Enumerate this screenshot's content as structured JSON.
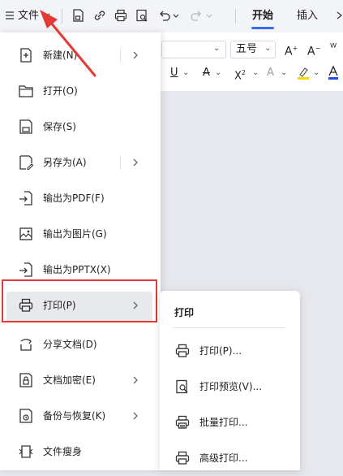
{
  "toolbar": {
    "file_label": "文件",
    "tabs": [
      {
        "label": "开始",
        "active": true
      },
      {
        "label": "插入",
        "active": false
      }
    ]
  },
  "ribbon": {
    "font_size": "五号"
  },
  "file_menu": {
    "items": [
      {
        "label": "新建(N)",
        "icon": "new-file-icon",
        "has_submenu": true
      },
      {
        "label": "打开(O)",
        "icon": "folder-icon",
        "has_submenu": false
      },
      {
        "label": "保存(S)",
        "icon": "save-icon",
        "has_submenu": false
      },
      {
        "label": "另存为(A)",
        "icon": "save-as-icon",
        "has_submenu": true
      },
      {
        "label": "输出为PDF(F)",
        "icon": "export-pdf-icon",
        "has_submenu": false
      },
      {
        "label": "输出为图片(G)",
        "icon": "export-image-icon",
        "has_submenu": false
      },
      {
        "label": "输出为PPTX(X)",
        "icon": "export-pptx-icon",
        "has_submenu": false
      },
      {
        "label": "打印(P)",
        "icon": "printer-icon",
        "has_submenu": true,
        "highlighted": true
      },
      {
        "label": "分享文档(D)",
        "icon": "share-icon",
        "has_submenu": false
      },
      {
        "label": "文档加密(E)",
        "icon": "encrypt-icon",
        "has_submenu": true
      },
      {
        "label": "备份与恢复(K)",
        "icon": "backup-icon",
        "has_submenu": true
      },
      {
        "label": "文件瘦身",
        "icon": "slim-icon",
        "has_submenu": false
      }
    ]
  },
  "print_submenu": {
    "title": "打印",
    "items": [
      {
        "label": "打印(P)...",
        "icon": "printer-icon"
      },
      {
        "label": "打印预览(V)...",
        "icon": "print-preview-icon"
      },
      {
        "label": "批量打印...",
        "icon": "batch-print-icon"
      },
      {
        "label": "高级打印...",
        "icon": "advanced-print-icon"
      }
    ]
  },
  "colors": {
    "accent": "#3b6cf6",
    "highlight_box": "#e53935",
    "annotation_arrow": "#e53935"
  }
}
